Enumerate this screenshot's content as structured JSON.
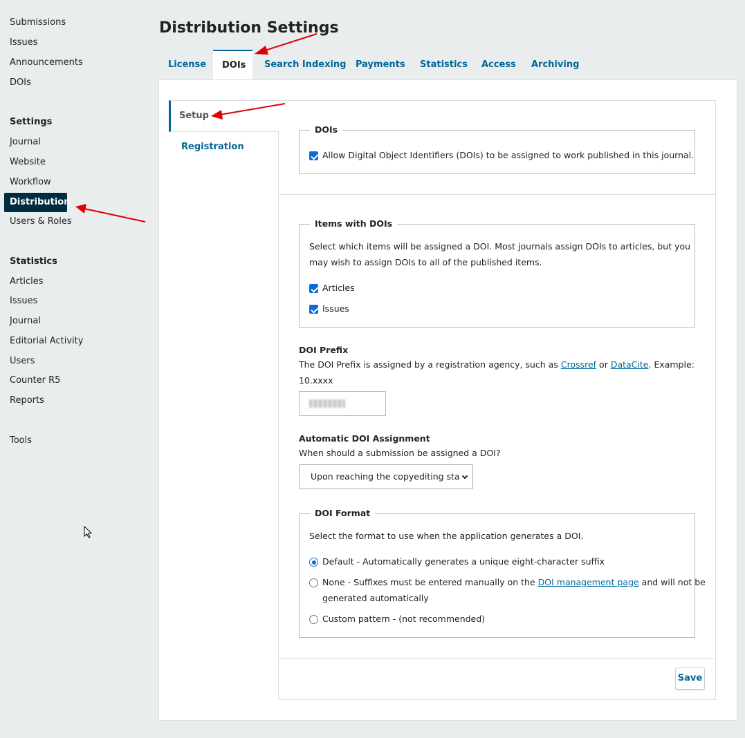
{
  "sidebar": {
    "items_top": [
      "Submissions",
      "Issues",
      "Announcements",
      "DOIs"
    ],
    "settings_heading": "Settings",
    "settings_items": [
      "Journal",
      "Website",
      "Workflow",
      "Distribution",
      "Users & Roles"
    ],
    "statistics_heading": "Statistics",
    "statistics_items": [
      "Articles",
      "Issues",
      "Journal",
      "Editorial Activity",
      "Users",
      "Counter R5",
      "Reports"
    ],
    "tools": "Tools"
  },
  "page": {
    "title": "Distribution Settings"
  },
  "tabs": [
    "License",
    "DOIs",
    "Search Indexing",
    "Payments",
    "Statistics",
    "Access",
    "Archiving"
  ],
  "active_tab": "DOIs",
  "subtabs": [
    "Setup",
    "Registration"
  ],
  "dois_section": {
    "legend": "DOIs",
    "allow_label": "Allow Digital Object Identifiers (DOIs) to be assigned to work published in this journal.",
    "allow_checked": true
  },
  "items_section": {
    "legend": "Items with DOIs",
    "description_line1": "Select which items will be assigned a DOI. Most journals assign DOIs to articles, but you",
    "description_line2": "may wish to assign DOIs to all of the published items.",
    "options": [
      {
        "label": "Articles",
        "checked": true
      },
      {
        "label": "Issues",
        "checked": true
      }
    ]
  },
  "prefix": {
    "label": "DOI Prefix",
    "desc_before": "The DOI Prefix is assigned by a registration agency, such as ",
    "link1": "Crossref",
    "desc_mid": " or ",
    "link2": "DataCite",
    "desc_after": ". Example:",
    "example": "10.xxxx"
  },
  "assignment": {
    "label": "Automatic DOI Assignment",
    "desc": "When should a submission be assigned a DOI?",
    "selected": "Upon reaching the copyediting sta"
  },
  "format": {
    "legend": "DOI Format",
    "desc": "Select the format to use when the application generates a DOI.",
    "option_default": "Default - Automatically generates a unique eight-character suffix",
    "option_none_before": "None - Suffixes must be entered manually on the ",
    "option_none_link": "DOI management page",
    "option_none_after": " and will not be",
    "option_none_line2": "generated automatically",
    "option_custom": "Custom pattern - (not recommended)",
    "selected": "Default"
  },
  "save_label": "Save",
  "colors": {
    "accent": "#006798",
    "active_nav_bg": "#002c40",
    "annotation_arrow": "#e00000"
  }
}
